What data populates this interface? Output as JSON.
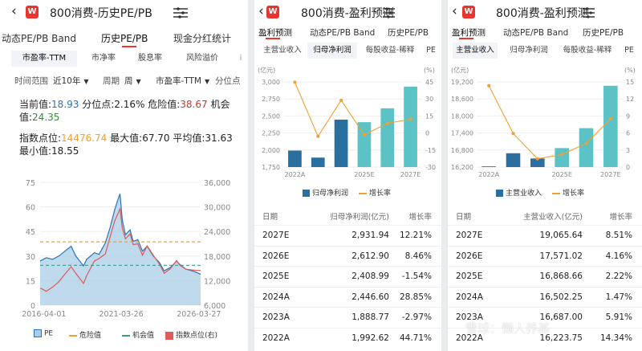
{
  "panels": {
    "left": {
      "title": "800消费-历史PE/PB",
      "tabs": [
        "动态PE/PB Band",
        "历史PE/PB",
        "现金分红统计"
      ],
      "active_tab": 1,
      "sub_tabs": [
        "市盈率-TTM",
        "市净率",
        "股息率",
        "风险溢价"
      ],
      "filters": {
        "range_label": "时间范围",
        "range_value": "近10年",
        "period_label": "周期",
        "period_value": "周",
        "metric_value": "市盈率-TTM",
        "quantile_label": "分位点"
      },
      "stats": {
        "current_label": "当前值:",
        "current_value": "18.93",
        "quantile_label": "分位点:",
        "quantile_value": "2.16%",
        "danger_label": "危险值:",
        "danger_value": "38.67",
        "chance_label": "机会值:",
        "chance_value": "24.35",
        "index_label": "指数点位:",
        "index_value": "14476.74",
        "max_label": "最大值:",
        "max_value": "67.70",
        "avg_label": "平均值:",
        "avg_value": "31.63",
        "min_label": "最小值:",
        "min_value": "18.55"
      },
      "legend": [
        "PE",
        "危险值",
        "机会值",
        "指数点位(右)"
      ]
    },
    "middle": {
      "title": "800消费-盈利预测",
      "tabs": [
        "盈利预测",
        "动态PE/PB Band",
        "历史PE/PB"
      ],
      "sub_tabs": [
        "主营业收入",
        "归母净利润",
        "每股收益-稀释",
        "PE"
      ],
      "active_sub_tab": 1,
      "legend": [
        "归母净利润",
        "增长率"
      ],
      "table_headers": [
        "日期",
        "归母净利润(亿元)",
        "增长率"
      ],
      "rows": [
        [
          "2027E",
          "2,931.94",
          "12.21%"
        ],
        [
          "2026E",
          "2,612.90",
          "8.46%"
        ],
        [
          "2025E",
          "2,408.99",
          "-1.54%"
        ],
        [
          "2024A",
          "2,446.60",
          "28.85%"
        ],
        [
          "2023A",
          "1,888.77",
          "-2.97%"
        ],
        [
          "2022A",
          "1,992.62",
          "44.71%"
        ]
      ]
    },
    "right": {
      "title": "800消费-盈利预测",
      "tabs": [
        "盈利预测",
        "动态PE/PB Band",
        "历史PE/PB"
      ],
      "sub_tabs": [
        "主营业收入",
        "归母净利润",
        "每股收益-稀释",
        "PE"
      ],
      "active_sub_tab": 0,
      "legend": [
        "主营业收入",
        "增长率"
      ],
      "table_headers": [
        "日期",
        "主营业收入(亿元)",
        "增长率"
      ],
      "rows": [
        [
          "2027E",
          "19,065.64",
          "8.51%"
        ],
        [
          "2026E",
          "17,571.02",
          "4.16%"
        ],
        [
          "2025E",
          "16,868.66",
          "2.22%"
        ],
        [
          "2024A",
          "16,502.25",
          "1.47%"
        ],
        [
          "2023A",
          "16,687.00",
          "5.91%"
        ],
        [
          "2022A",
          "16,223.75",
          "14.34%"
        ]
      ],
      "watermark": "雪球：懒人养基"
    }
  },
  "colors": {
    "accent_red": "#e8352d",
    "pe_line": "#2a73b8",
    "pe_fill": "#a9cde6",
    "danger": "#f0a030",
    "chance": "#3a9e8a",
    "index_line": "#e05a5a",
    "bar_actual": "#2a6f9e",
    "bar_estimate": "#5cc2c6",
    "growth_line": "#f0a030"
  },
  "chart_data": [
    {
      "type": "line",
      "ylim": [
        0,
        75
      ],
      "y_ticks": [
        "0",
        "15",
        "30",
        "45",
        "60",
        "75"
      ],
      "y2lim": [
        6000,
        36000
      ],
      "y2_ticks": [
        "6,000",
        "12,000",
        "18,000",
        "24,000",
        "30,000",
        "36,000"
      ],
      "x_ticks": [
        "2016-04-01",
        "2021-03-26",
        "2026-03-27"
      ],
      "xlim": [
        2016.0,
        2026.35
      ],
      "x_tick_values": [
        2016.25,
        2021.23,
        2026.24
      ],
      "danger": 38.67,
      "chance": 24.35,
      "series": [
        {
          "name": "PE",
          "x": [
            2016.0,
            2016.4,
            2016.8,
            2017.2,
            2017.6,
            2018.0,
            2018.3,
            2018.8,
            2019.0,
            2019.5,
            2019.8,
            2020.2,
            2020.5,
            2020.8,
            2021.0,
            2021.15,
            2021.3,
            2021.5,
            2021.8,
            2022.0,
            2022.3,
            2022.6,
            2022.9,
            2023.3,
            2023.7,
            2024.0,
            2024.4,
            2024.8,
            2025.0,
            2025.4,
            2025.8,
            2026.1,
            2026.35
          ],
          "y": [
            27,
            29,
            28,
            30,
            33,
            36,
            30,
            24,
            28,
            32,
            31,
            38,
            47,
            58,
            64,
            68,
            52,
            43,
            46,
            39,
            40,
            33,
            36,
            30,
            26,
            21,
            23,
            27,
            25,
            22,
            21,
            20,
            18.9
          ]
        },
        {
          "name": "指数点位(右)",
          "x": [
            2016.0,
            2016.4,
            2016.8,
            2017.2,
            2017.6,
            2018.0,
            2018.3,
            2018.8,
            2019.0,
            2019.5,
            2019.8,
            2020.2,
            2020.5,
            2020.8,
            2021.0,
            2021.15,
            2021.3,
            2021.5,
            2021.8,
            2022.0,
            2022.3,
            2022.6,
            2022.9,
            2023.3,
            2023.7,
            2024.0,
            2024.4,
            2024.8,
            2025.0,
            2025.4,
            2025.8,
            2026.1,
            2026.35
          ],
          "y": [
            10200,
            9400,
            10400,
            11700,
            13600,
            15400,
            13800,
            11300,
            13200,
            16800,
            17400,
            18500,
            22500,
            26500,
            28200,
            29500,
            24800,
            22200,
            23400,
            20800,
            21000,
            18200,
            20500,
            18200,
            16000,
            13800,
            14900,
            16900,
            15800,
            14800,
            14600,
            14500,
            14477
          ]
        }
      ]
    },
    {
      "type": "bar",
      "categories": [
        "2022A",
        "2023A",
        "2024A",
        "2025E",
        "2026E",
        "2027E"
      ],
      "ylim": [
        1750,
        3000
      ],
      "y_ticks": [
        "1,750",
        "2,000",
        "2,250",
        "2,500",
        "2,750",
        "3,000"
      ],
      "y2lim": [
        -30,
        45
      ],
      "y2_ticks": [
        "-30",
        "-15",
        "0",
        "15",
        "30",
        "45"
      ],
      "y2_unit": "(%)",
      "y_unit": "(亿元)",
      "x_ticks": [
        "2022A",
        "2025E",
        "2027E"
      ],
      "series": [
        {
          "name": "归母净利润",
          "values": [
            1992.62,
            1888.77,
            2446.6,
            2408.99,
            2612.9,
            2931.94
          ]
        },
        {
          "name": "增长率",
          "values": [
            44.71,
            -2.97,
            28.85,
            -1.54,
            8.46,
            12.21
          ]
        }
      ]
    },
    {
      "type": "bar",
      "categories": [
        "2022A",
        "2023A",
        "2024A",
        "2025E",
        "2026E",
        "2027E"
      ],
      "ylim": [
        16200,
        19200
      ],
      "y_ticks": [
        "16,200",
        "16,800",
        "17,400",
        "18,000",
        "18,600",
        "19,200"
      ],
      "y2lim": [
        0,
        15
      ],
      "y2_ticks": [
        "0",
        "3",
        "6",
        "9",
        "12",
        "15"
      ],
      "y2_unit": "(%)",
      "y_unit": "(亿元)",
      "x_ticks": [
        "2022A",
        "2025E",
        "2027E"
      ],
      "series": [
        {
          "name": "主营业收入",
          "values": [
            16223.75,
            16687.0,
            16502.25,
            16868.66,
            17571.02,
            19065.64
          ]
        },
        {
          "name": "增长率",
          "values": [
            14.34,
            5.91,
            1.47,
            2.22,
            4.16,
            8.51
          ]
        }
      ]
    }
  ]
}
